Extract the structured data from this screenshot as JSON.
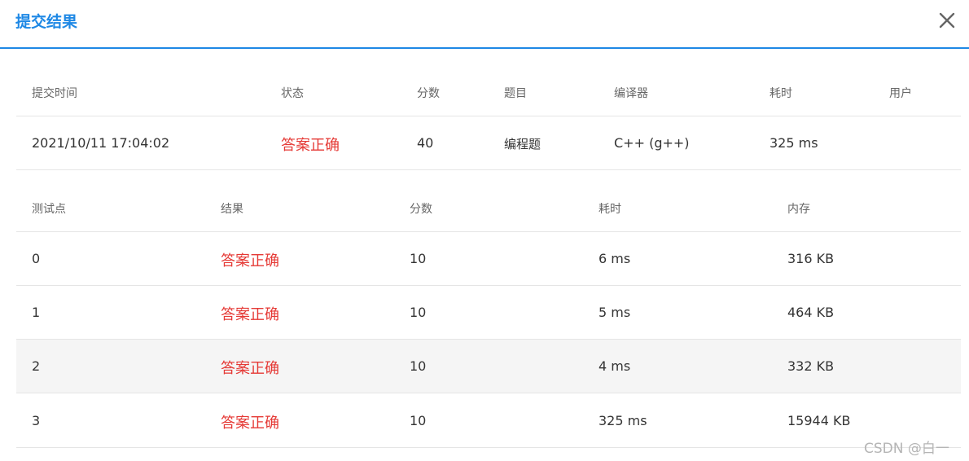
{
  "dialog": {
    "title": "提交结果",
    "close_icon": "close-icon"
  },
  "submission": {
    "headers": [
      "提交时间",
      "状态",
      "分数",
      "题目",
      "编译器",
      "耗时",
      "用户"
    ],
    "row": {
      "time": "2021/10/11 17:04:02",
      "status": "答案正确",
      "score": "40",
      "problem": "编程题",
      "compiler": "C++ (g++)",
      "elapsed": "325 ms",
      "user": ""
    }
  },
  "testcases": {
    "headers": [
      "测试点",
      "结果",
      "分数",
      "耗时",
      "内存"
    ],
    "rows": [
      {
        "id": "0",
        "result": "答案正确",
        "score": "10",
        "time": "6 ms",
        "memory": "316 KB"
      },
      {
        "id": "1",
        "result": "答案正确",
        "score": "10",
        "time": "5 ms",
        "memory": "464 KB"
      },
      {
        "id": "2",
        "result": "答案正确",
        "score": "10",
        "time": "4 ms",
        "memory": "332 KB"
      },
      {
        "id": "3",
        "result": "答案正确",
        "score": "10",
        "time": "325 ms",
        "memory": "15944 KB"
      }
    ]
  },
  "colors": {
    "accent": "#1e88e5",
    "status_ok": "#e53935"
  },
  "watermark": "CSDN @白一"
}
